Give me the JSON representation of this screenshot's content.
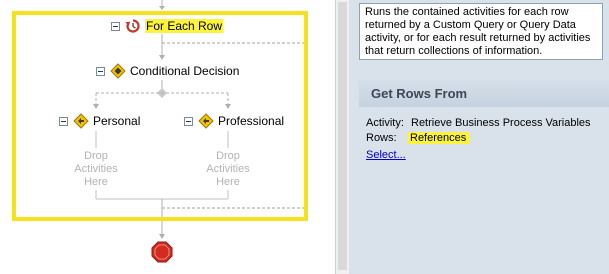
{
  "workflow": {
    "loop": {
      "label": "For Each Row",
      "icon": "loop-arrow-icon"
    },
    "decision": {
      "label": "Conditional Decision",
      "icon": "decision-diamond-icon"
    },
    "branches": [
      {
        "label": "Personal",
        "drop_text": "Drop Activities Here"
      },
      {
        "label": "Professional",
        "drop_text": "Drop Activities Here"
      }
    ],
    "end": {
      "icon": "stop-sign-icon"
    }
  },
  "properties": {
    "description": "Runs the contained activities for each row returned by a Custom Query or Query Data activity, or for each result returned by activities that return collections of information.",
    "section_title": "Get Rows From",
    "activity_label": "Activity:",
    "activity_value": "Retrieve Business Process Variables",
    "rows_label": "Rows:",
    "rows_value": "References",
    "select_link": "Select..."
  },
  "colors": {
    "highlight": "#fbf33e",
    "loop_frame": "#f5e21b",
    "panel_background": "#d9e1ea",
    "link": "#0000cc",
    "connector": "#b0b0b0"
  }
}
